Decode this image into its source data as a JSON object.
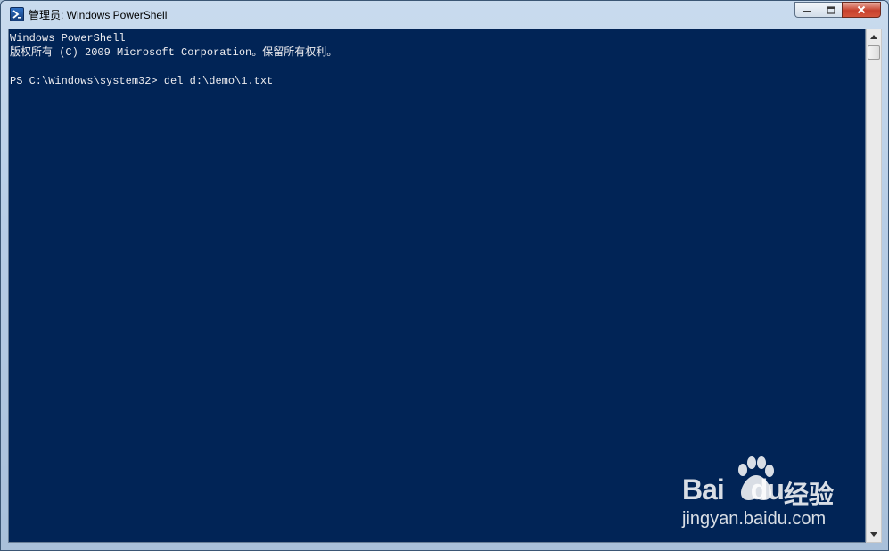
{
  "window": {
    "title": "管理员: Windows PowerShell",
    "app_icon": "powershell-icon"
  },
  "caption_buttons": [
    "minimize-icon",
    "maximize-icon",
    "close-icon"
  ],
  "console": {
    "lines": [
      "Windows PowerShell",
      "版权所有 (C) 2009 Microsoft Corporation。保留所有权利。",
      "",
      "PS C:\\Windows\\system32> del d:\\demo\\1.txt"
    ],
    "background_color": "#012456",
    "text_color": "#eeedf0"
  },
  "watermark": {
    "brand_text": "Bai",
    "brand_text_2": "du",
    "brand_hanzi": "经验",
    "url": "jingyan.baidu.com"
  }
}
